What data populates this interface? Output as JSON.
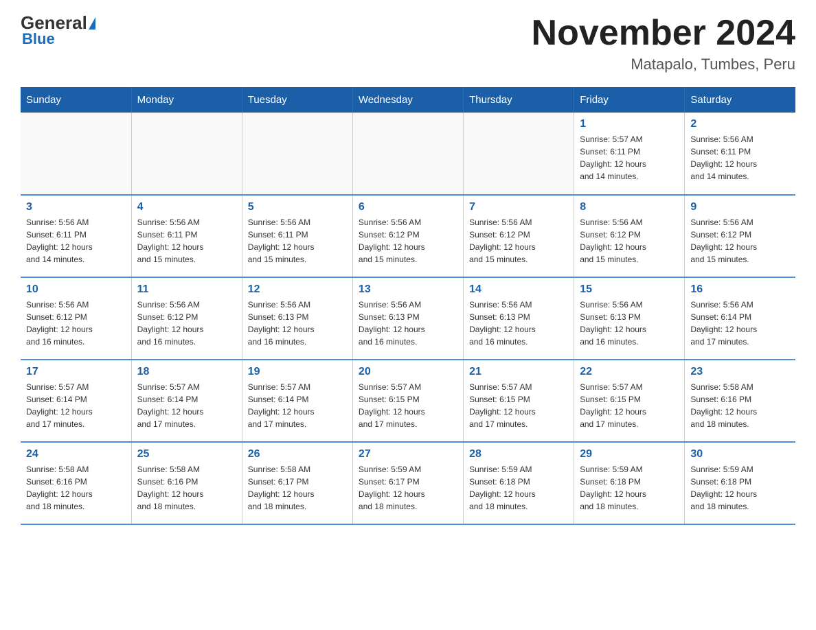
{
  "logo": {
    "general": "General",
    "blue": "Blue",
    "subtitle": "Blue"
  },
  "title": "November 2024",
  "subtitle": "Matapalo, Tumbes, Peru",
  "headers": [
    "Sunday",
    "Monday",
    "Tuesday",
    "Wednesday",
    "Thursday",
    "Friday",
    "Saturday"
  ],
  "weeks": [
    [
      {
        "day": "",
        "info": ""
      },
      {
        "day": "",
        "info": ""
      },
      {
        "day": "",
        "info": ""
      },
      {
        "day": "",
        "info": ""
      },
      {
        "day": "",
        "info": ""
      },
      {
        "day": "1",
        "info": "Sunrise: 5:57 AM\nSunset: 6:11 PM\nDaylight: 12 hours\nand 14 minutes."
      },
      {
        "day": "2",
        "info": "Sunrise: 5:56 AM\nSunset: 6:11 PM\nDaylight: 12 hours\nand 14 minutes."
      }
    ],
    [
      {
        "day": "3",
        "info": "Sunrise: 5:56 AM\nSunset: 6:11 PM\nDaylight: 12 hours\nand 14 minutes."
      },
      {
        "day": "4",
        "info": "Sunrise: 5:56 AM\nSunset: 6:11 PM\nDaylight: 12 hours\nand 15 minutes."
      },
      {
        "day": "5",
        "info": "Sunrise: 5:56 AM\nSunset: 6:11 PM\nDaylight: 12 hours\nand 15 minutes."
      },
      {
        "day": "6",
        "info": "Sunrise: 5:56 AM\nSunset: 6:12 PM\nDaylight: 12 hours\nand 15 minutes."
      },
      {
        "day": "7",
        "info": "Sunrise: 5:56 AM\nSunset: 6:12 PM\nDaylight: 12 hours\nand 15 minutes."
      },
      {
        "day": "8",
        "info": "Sunrise: 5:56 AM\nSunset: 6:12 PM\nDaylight: 12 hours\nand 15 minutes."
      },
      {
        "day": "9",
        "info": "Sunrise: 5:56 AM\nSunset: 6:12 PM\nDaylight: 12 hours\nand 15 minutes."
      }
    ],
    [
      {
        "day": "10",
        "info": "Sunrise: 5:56 AM\nSunset: 6:12 PM\nDaylight: 12 hours\nand 16 minutes."
      },
      {
        "day": "11",
        "info": "Sunrise: 5:56 AM\nSunset: 6:12 PM\nDaylight: 12 hours\nand 16 minutes."
      },
      {
        "day": "12",
        "info": "Sunrise: 5:56 AM\nSunset: 6:13 PM\nDaylight: 12 hours\nand 16 minutes."
      },
      {
        "day": "13",
        "info": "Sunrise: 5:56 AM\nSunset: 6:13 PM\nDaylight: 12 hours\nand 16 minutes."
      },
      {
        "day": "14",
        "info": "Sunrise: 5:56 AM\nSunset: 6:13 PM\nDaylight: 12 hours\nand 16 minutes."
      },
      {
        "day": "15",
        "info": "Sunrise: 5:56 AM\nSunset: 6:13 PM\nDaylight: 12 hours\nand 16 minutes."
      },
      {
        "day": "16",
        "info": "Sunrise: 5:56 AM\nSunset: 6:14 PM\nDaylight: 12 hours\nand 17 minutes."
      }
    ],
    [
      {
        "day": "17",
        "info": "Sunrise: 5:57 AM\nSunset: 6:14 PM\nDaylight: 12 hours\nand 17 minutes."
      },
      {
        "day": "18",
        "info": "Sunrise: 5:57 AM\nSunset: 6:14 PM\nDaylight: 12 hours\nand 17 minutes."
      },
      {
        "day": "19",
        "info": "Sunrise: 5:57 AM\nSunset: 6:14 PM\nDaylight: 12 hours\nand 17 minutes."
      },
      {
        "day": "20",
        "info": "Sunrise: 5:57 AM\nSunset: 6:15 PM\nDaylight: 12 hours\nand 17 minutes."
      },
      {
        "day": "21",
        "info": "Sunrise: 5:57 AM\nSunset: 6:15 PM\nDaylight: 12 hours\nand 17 minutes."
      },
      {
        "day": "22",
        "info": "Sunrise: 5:57 AM\nSunset: 6:15 PM\nDaylight: 12 hours\nand 17 minutes."
      },
      {
        "day": "23",
        "info": "Sunrise: 5:58 AM\nSunset: 6:16 PM\nDaylight: 12 hours\nand 18 minutes."
      }
    ],
    [
      {
        "day": "24",
        "info": "Sunrise: 5:58 AM\nSunset: 6:16 PM\nDaylight: 12 hours\nand 18 minutes."
      },
      {
        "day": "25",
        "info": "Sunrise: 5:58 AM\nSunset: 6:16 PM\nDaylight: 12 hours\nand 18 minutes."
      },
      {
        "day": "26",
        "info": "Sunrise: 5:58 AM\nSunset: 6:17 PM\nDaylight: 12 hours\nand 18 minutes."
      },
      {
        "day": "27",
        "info": "Sunrise: 5:59 AM\nSunset: 6:17 PM\nDaylight: 12 hours\nand 18 minutes."
      },
      {
        "day": "28",
        "info": "Sunrise: 5:59 AM\nSunset: 6:18 PM\nDaylight: 12 hours\nand 18 minutes."
      },
      {
        "day": "29",
        "info": "Sunrise: 5:59 AM\nSunset: 6:18 PM\nDaylight: 12 hours\nand 18 minutes."
      },
      {
        "day": "30",
        "info": "Sunrise: 5:59 AM\nSunset: 6:18 PM\nDaylight: 12 hours\nand 18 minutes."
      }
    ]
  ]
}
